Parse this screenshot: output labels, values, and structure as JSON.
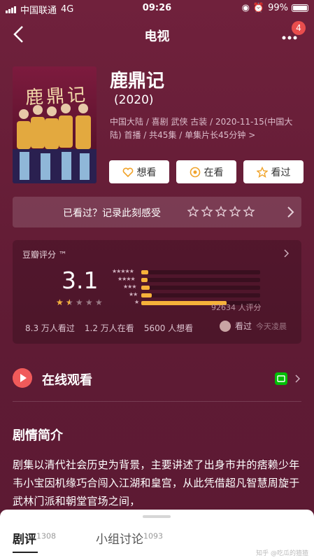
{
  "status": {
    "carrier": "中国联通",
    "network": "4G",
    "time": "09:26",
    "battery": "99%",
    "battery_level": 0.99
  },
  "nav": {
    "title": "电视",
    "badge": "4"
  },
  "show": {
    "poster_text": "鹿鼎记",
    "title": "鹿鼎记",
    "year": "(2020)",
    "meta": "中国大陆 / 喜剧 武侠 古装 / 2020-11-15(中国大陆) 首播 / 共45集 / 单集片长45分钟 >"
  },
  "actions": {
    "want": "想看",
    "watching": "在看",
    "watched": "看过"
  },
  "record": {
    "text": "已看过？记录此刻感受"
  },
  "rating": {
    "header": "豆瓣评分 ™",
    "score": "3.1",
    "score_stars": 1.5,
    "distribution": [
      {
        "stars": "★★★★★",
        "fraction": 0.06
      },
      {
        "stars": "★★★★",
        "fraction": 0.05
      },
      {
        "stars": "★★★",
        "fraction": 0.07
      },
      {
        "stars": "★★",
        "fraction": 0.09
      },
      {
        "stars": "★",
        "fraction": 0.72
      }
    ],
    "count": "92634 人评分",
    "watched": "8.3 万人看过",
    "watching": "1.2 万人在看",
    "want": "5600 人想看",
    "friend_status": "看过",
    "friend_time": "今天凌晨"
  },
  "online": {
    "label": "在线观看"
  },
  "synopsis": {
    "header": "剧情简介",
    "text": "剧集以清代社会历史为背景，主要讲述了出身市井的痞赖少年韦小宝因机缘巧合闯入江湖和皇宫，从此凭借超凡智慧周旋于武林门派和朝堂官场之间，"
  },
  "tabs": [
    {
      "label": "剧评",
      "count": "1308"
    },
    {
      "label": "小组讨论",
      "count": "1093"
    }
  ],
  "watermark": "知乎 @吃瓜的猹猹"
}
